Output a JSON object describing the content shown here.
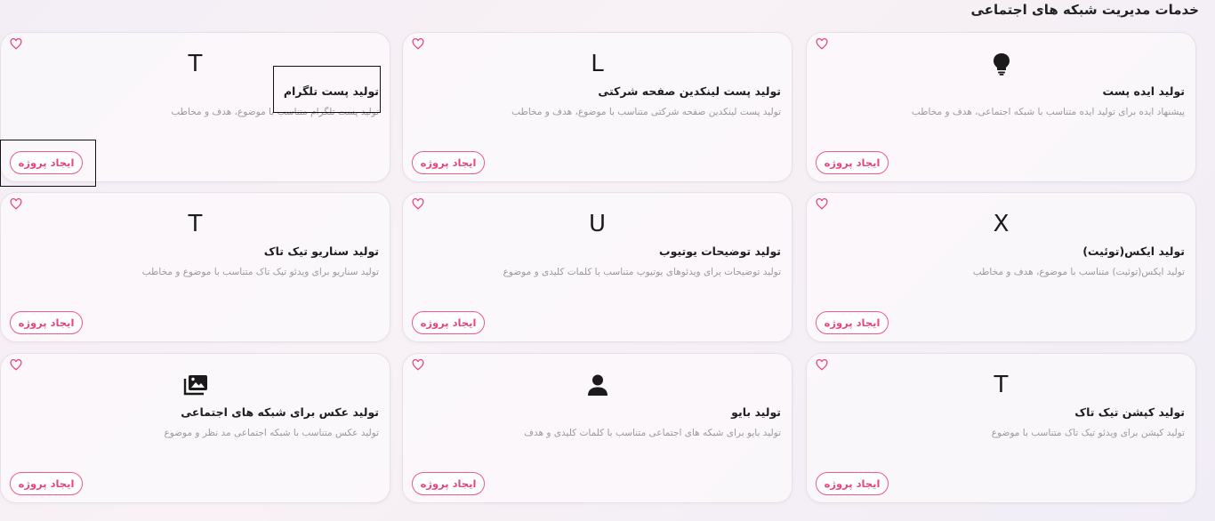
{
  "section_title": "خدمات مدیریت شبکه های اجتماعی",
  "button_label": "ایجاد پروژه",
  "cards": [
    {
      "icon": "lightbulb-icon",
      "glyph": "",
      "title": "تولید ایده پست",
      "desc": "پیشنهاد ایده برای تولید ایده متناسب با شبکه اجتماعی، هدف و مخاطب"
    },
    {
      "icon": "letter-l-icon",
      "glyph": "L",
      "title": "تولید پست لینکدین صفحه شرکتی",
      "desc": "تولید پست لینکدین صفحه شرکتی متناسب با موضوع، هدف و مخاطب"
    },
    {
      "icon": "letter-t-icon",
      "glyph": "T",
      "title": "تولید پست تلگرام",
      "desc": "تولید پست تلگرام متناسب با موضوع، هدف و مخاطب"
    },
    {
      "icon": "letter-x-icon",
      "glyph": "X",
      "title": "تولید ایکس(توئیت)",
      "desc": "تولید ایکس(توئیت) متناسب با موضوع، هدف و مخاطب"
    },
    {
      "icon": "letter-u-icon",
      "glyph": "U",
      "title": "تولید توضیحات یوتیوب",
      "desc": "تولید توضیحات برای ویدئوهای یوتیوب متناسب با کلمات کلیدی و موضوع"
    },
    {
      "icon": "letter-t-icon",
      "glyph": "T",
      "title": "تولید سناریو تیک تاک",
      "desc": "تولید سناریو برای ویدئو تیک تاک متناسب با موضوع و مخاطب"
    },
    {
      "icon": "letter-t-icon",
      "glyph": "T",
      "title": "تولید کپشن تیک تاک",
      "desc": "تولید کپشن برای ویدئو تیک تاک متناسب با موضوع"
    },
    {
      "icon": "person-icon",
      "glyph": "",
      "title": "تولید بایو",
      "desc": "تولید بایو برای شبکه های اجتماعی متناسب با کلمات کلیدی و هدف"
    },
    {
      "icon": "photo-library-icon",
      "glyph": "",
      "title": "تولید عکس برای شبکه های اجتماعی",
      "desc": "تولید عکس متناسب با شبکه اجتماعی مد نظر و موضوع"
    }
  ]
}
